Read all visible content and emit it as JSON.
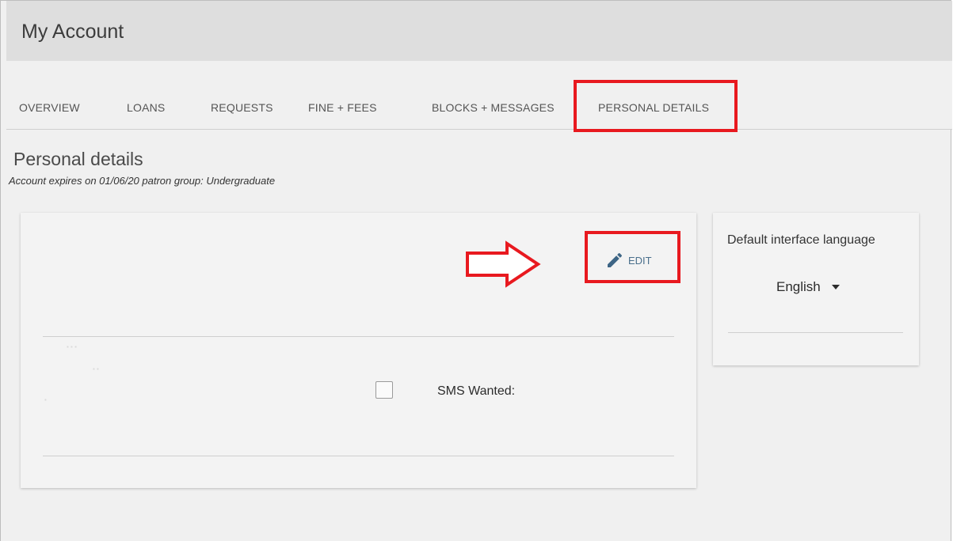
{
  "header": {
    "title": "My Account"
  },
  "tabs": [
    {
      "label": "OVERVIEW"
    },
    {
      "label": "LOANS"
    },
    {
      "label": "REQUESTS"
    },
    {
      "label": "FINE + FEES"
    },
    {
      "label": "BLOCKS + MESSAGES"
    },
    {
      "label": "PERSONAL DETAILS",
      "selected": true
    }
  ],
  "section": {
    "title": "Personal details",
    "subtitle": "Account expires on 01/06/20 patron group: Undergraduate"
  },
  "details_card": {
    "edit_label": "EDIT",
    "edit_icon": "pencil-icon",
    "sms_label": "SMS Wanted:",
    "sms_checked": false
  },
  "language_card": {
    "title": "Default interface language",
    "selected_language": "English"
  },
  "annotations": {
    "highlight_color": "#e8191f",
    "arrow_icon": "right-arrow-icon"
  },
  "colors": {
    "header_bg": "#dedede",
    "page_bg": "#f0f0f0",
    "link_color": "#4a6f8c"
  }
}
